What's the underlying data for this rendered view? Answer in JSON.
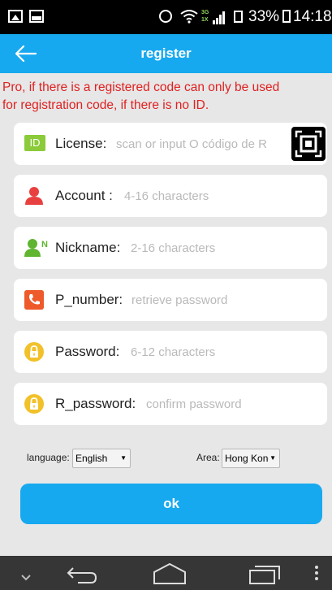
{
  "status_bar": {
    "battery": "33%",
    "time": "14:18",
    "network_tag_top": "3G",
    "network_tag_bottom": "1X"
  },
  "header": {
    "title": "register",
    "back_icon": "arrow-left-icon"
  },
  "warning": {
    "line1": "Pro, if there is a registered code can only be used",
    "line2": "for registration code, if there is no ID.",
    "color": "#e02020"
  },
  "fields": [
    {
      "label": "License:",
      "placeholder": "scan or input O código de R",
      "icon": "id-icon"
    },
    {
      "label": "Account :",
      "placeholder": "4-16 characters",
      "icon": "person-icon"
    },
    {
      "label": "Nickname:",
      "placeholder": "2-16 characters",
      "icon": "person-n-icon"
    },
    {
      "label": "P_number:",
      "placeholder": "retrieve password",
      "icon": "phone-icon"
    },
    {
      "label": "Password:",
      "placeholder": "6-12 characters",
      "icon": "lock-icon"
    },
    {
      "label": "R_password:",
      "placeholder": "confirm password",
      "icon": "lock-icon"
    }
  ],
  "license_badge": "ID",
  "options": {
    "language_label": "language:",
    "language_value": "English",
    "area_label": "Area:",
    "area_value": "Hong Kong"
  },
  "ok_button": {
    "label": "ok"
  },
  "colors": {
    "accent": "#17a9ef",
    "background": "#e7e7e7",
    "nav_bar": "#363636",
    "id_green": "#8bcb3a",
    "lock_yellow": "#f2c12a",
    "person_red": "#e84040",
    "phone_orange": "#ee5a2a"
  }
}
